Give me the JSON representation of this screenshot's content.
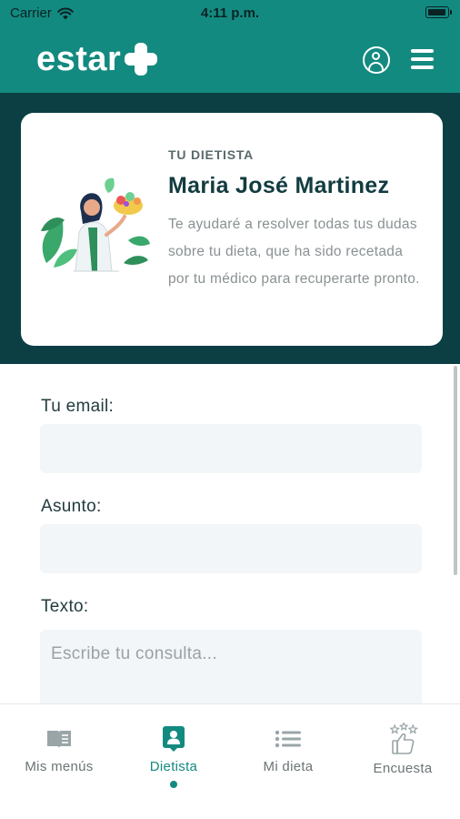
{
  "status_bar": {
    "carrier": "Carrier",
    "time": "4:11 p.m."
  },
  "header": {
    "logo_text": "estar"
  },
  "dietitian_card": {
    "kicker": "TU DIETISTA",
    "name": "Maria José Martinez",
    "description": "Te ayudaré a resolver todas tus dudas sobre tu dieta, que ha sido recetada por tu médico para recuperarte pronto."
  },
  "form": {
    "email_label": "Tu email:",
    "email_value": "",
    "subject_label": "Asunto:",
    "subject_value": "",
    "text_label": "Texto:",
    "text_placeholder": "Escribe tu consulta..."
  },
  "tabs": [
    {
      "label": "Mis menús",
      "icon": "book-icon",
      "active": false
    },
    {
      "label": "Dietista",
      "icon": "contact-card-icon",
      "active": true
    },
    {
      "label": "Mi dieta",
      "icon": "list-icon",
      "active": false
    },
    {
      "label": "Encuesta",
      "icon": "thumbs-up-stars-icon",
      "active": false
    }
  ],
  "colors": {
    "primary": "#138a80",
    "dark_band": "#0b3f44",
    "field_bg": "#f3f6f8"
  }
}
